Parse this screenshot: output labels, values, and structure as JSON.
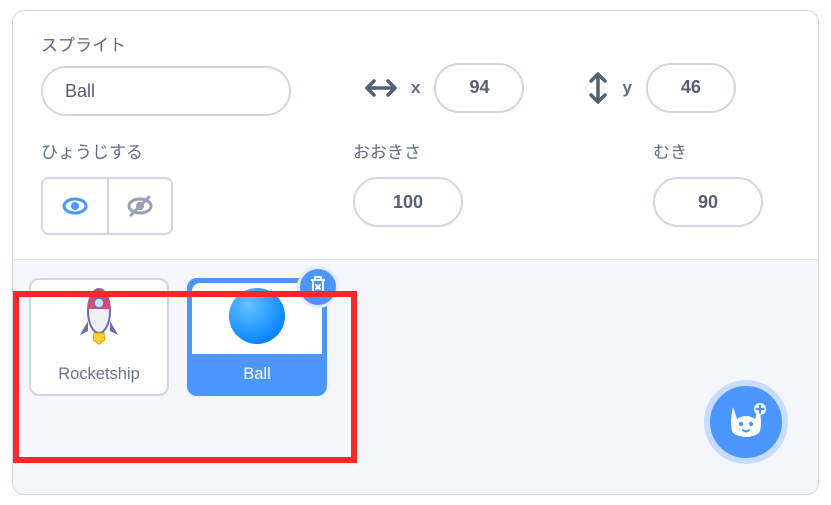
{
  "labels": {
    "sprite": "スプライト",
    "show": "ひょうじする",
    "size": "おおきさ",
    "direction": "むき",
    "x": "x",
    "y": "y"
  },
  "sprite": {
    "name": "Ball",
    "x": "94",
    "y": "46",
    "size": "100",
    "direction": "90"
  },
  "sprites": [
    {
      "name": "Rocketship",
      "selected": false
    },
    {
      "name": "Ball",
      "selected": true
    }
  ]
}
